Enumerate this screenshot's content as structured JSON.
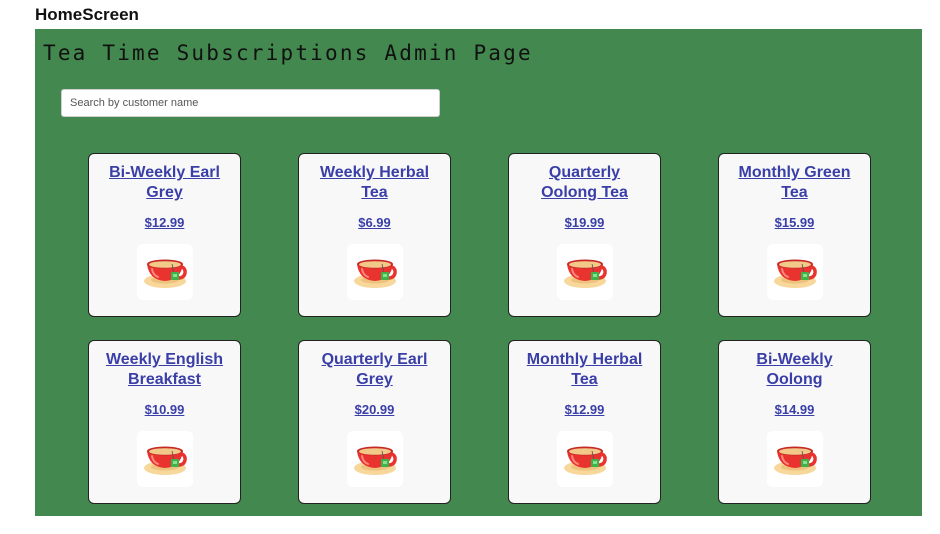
{
  "screen_label": "HomeScreen",
  "page": {
    "title": "Tea Time Subscriptions Admin Page",
    "background_color": "#43894f"
  },
  "search": {
    "placeholder": "Search by customer name",
    "value": ""
  },
  "subscriptions": [
    {
      "title": "Bi-Weekly Earl Grey",
      "price": "$12.99",
      "icon": "tea-cup-icon"
    },
    {
      "title": "Weekly Herbal Tea",
      "price": "$6.99",
      "icon": "tea-cup-icon"
    },
    {
      "title": "Quarterly Oolong Tea",
      "price": "$19.99",
      "icon": "tea-cup-icon"
    },
    {
      "title": "Monthly Green Tea",
      "price": "$15.99",
      "icon": "tea-cup-icon"
    },
    {
      "title": "Weekly English Breakfast",
      "price": "$10.99",
      "icon": "tea-cup-icon"
    },
    {
      "title": "Quarterly Earl Grey",
      "price": "$20.99",
      "icon": "tea-cup-icon"
    },
    {
      "title": "Monthly Herbal Tea",
      "price": "$12.99",
      "icon": "tea-cup-icon"
    },
    {
      "title": "Bi-Weekly Oolong",
      "price": "$14.99",
      "icon": "tea-cup-icon"
    }
  ],
  "colors": {
    "link": "#3a3fa8",
    "card_background": "#f8f8f8",
    "cup_red": "#e8332f",
    "saucer": "#f7d79a",
    "tea_bag_tag": "#3db34a"
  }
}
